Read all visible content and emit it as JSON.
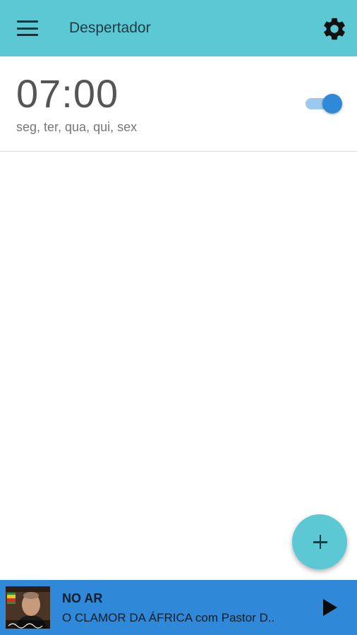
{
  "appbar": {
    "title": "Despertador",
    "menu_icon": "hamburger-menu-icon",
    "settings_icon": "gear-icon",
    "background_color": "#5bc8d4"
  },
  "alarm": {
    "time": "07:00",
    "days": "seg, ter, qua, qui, sex",
    "enabled": true,
    "toggle_color": "#2f88d8"
  },
  "fab": {
    "icon": "plus-icon",
    "color": "#5bc8d4"
  },
  "player": {
    "status": "NO AR",
    "program": "O CLAMOR DA ÁFRICA com Pastor D..",
    "play_icon": "play-icon",
    "background_color": "#2f88d8"
  }
}
